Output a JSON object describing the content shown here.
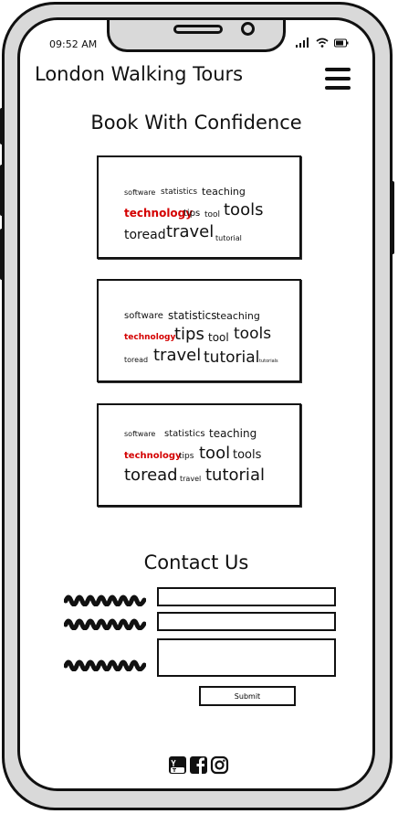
{
  "status_bar": {
    "time": "09:52 AM",
    "icons": [
      "signal-icon",
      "wifi-icon",
      "battery-icon"
    ]
  },
  "header": {
    "title": "London Walking Tours",
    "menu_icon": "hamburger-menu-icon"
  },
  "booking": {
    "heading": "Book With Confidence",
    "word_clouds": [
      {
        "words": [
          {
            "text": "software",
            "emphasis": "small"
          },
          {
            "text": "statistics",
            "emphasis": "small"
          },
          {
            "text": "teaching",
            "emphasis": "small"
          },
          {
            "text": "technology",
            "emphasis": "highlight"
          },
          {
            "text": "tips",
            "emphasis": "small"
          },
          {
            "text": "tool",
            "emphasis": "small"
          },
          {
            "text": "tools",
            "emphasis": "large"
          },
          {
            "text": "toread",
            "emphasis": "medium"
          },
          {
            "text": "travel",
            "emphasis": "large"
          },
          {
            "text": "tutorial",
            "emphasis": "tiny"
          }
        ]
      },
      {
        "words": [
          {
            "text": "software",
            "emphasis": "small"
          },
          {
            "text": "statistics",
            "emphasis": "small"
          },
          {
            "text": "teaching",
            "emphasis": "small"
          },
          {
            "text": "technology",
            "emphasis": "highlight"
          },
          {
            "text": "tips",
            "emphasis": "large"
          },
          {
            "text": "tool",
            "emphasis": "small"
          },
          {
            "text": "tools",
            "emphasis": "large"
          },
          {
            "text": "toread",
            "emphasis": "tiny"
          },
          {
            "text": "travel",
            "emphasis": "large"
          },
          {
            "text": "tutorial",
            "emphasis": "large"
          },
          {
            "text": "tutorials",
            "emphasis": "tiny"
          }
        ]
      },
      {
        "words": [
          {
            "text": "software",
            "emphasis": "small"
          },
          {
            "text": "statistics",
            "emphasis": "small"
          },
          {
            "text": "teaching",
            "emphasis": "small"
          },
          {
            "text": "technology",
            "emphasis": "highlight"
          },
          {
            "text": "tips",
            "emphasis": "tiny"
          },
          {
            "text": "tool",
            "emphasis": "large"
          },
          {
            "text": "tools",
            "emphasis": "small"
          },
          {
            "text": "toread",
            "emphasis": "large"
          },
          {
            "text": "travel",
            "emphasis": "tiny"
          },
          {
            "text": "tutorial",
            "emphasis": "large"
          }
        ]
      }
    ]
  },
  "contact": {
    "heading": "Contact Us",
    "fields": [
      {
        "label_style": "scribble",
        "value": ""
      },
      {
        "label_style": "scribble",
        "value": ""
      },
      {
        "label_style": "scribble",
        "value": ""
      }
    ],
    "submit_label": "Submit"
  },
  "footer": {
    "social_icons": [
      "youtube-icon",
      "facebook-icon",
      "instagram-icon"
    ]
  },
  "colors": {
    "highlight": "#d40000",
    "frame": "#d9d9d9",
    "ink": "#111111"
  }
}
